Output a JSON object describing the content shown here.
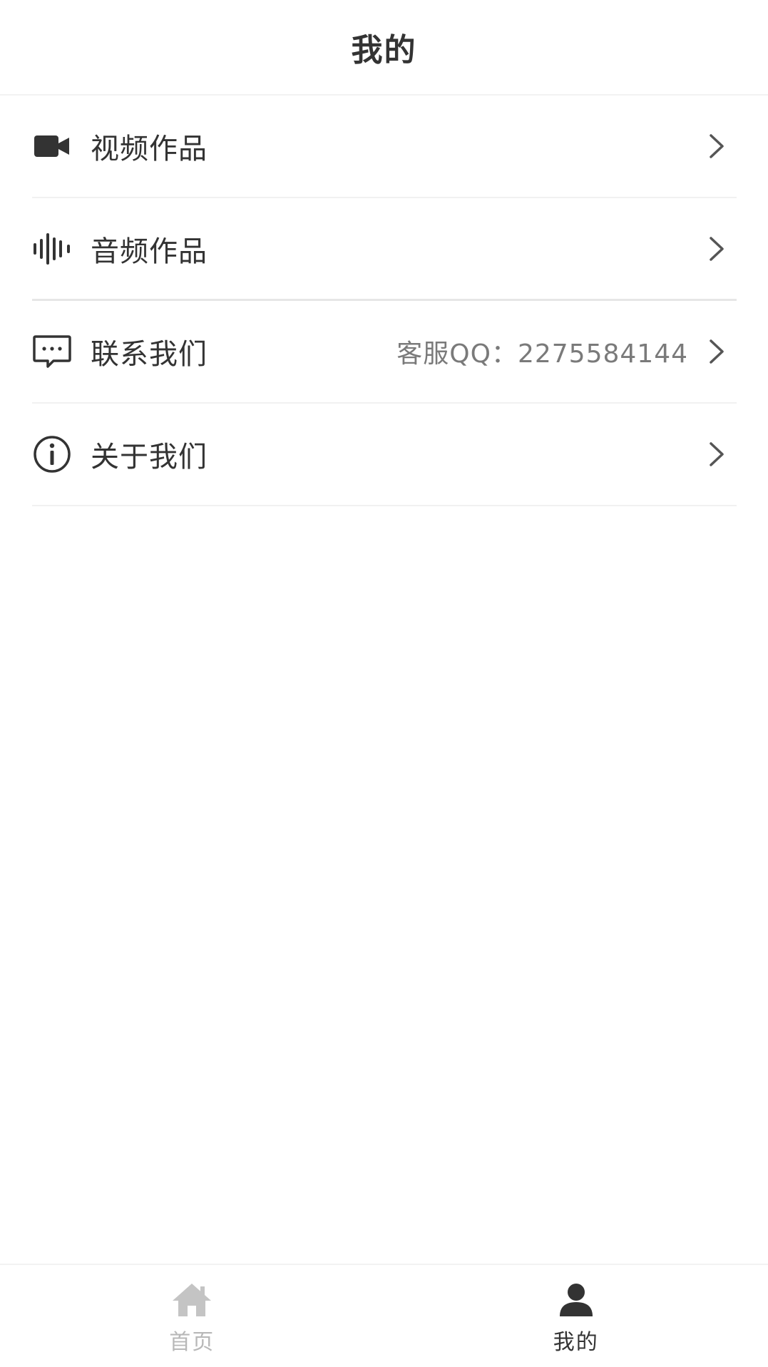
{
  "header": {
    "title": "我的"
  },
  "menu": {
    "items": [
      {
        "label": "视频作品",
        "icon": "video-camera-icon"
      },
      {
        "label": "音频作品",
        "icon": "audio-waveform-icon"
      },
      {
        "label": "联系我们",
        "icon": "message-icon",
        "extra": "客服QQ：2275584144"
      },
      {
        "label": "关于我们",
        "icon": "info-icon"
      }
    ]
  },
  "tabbar": {
    "tabs": [
      {
        "label": "首页",
        "icon": "home-icon",
        "active": false
      },
      {
        "label": "我的",
        "icon": "user-icon",
        "active": true
      }
    ]
  },
  "colors": {
    "text_primary": "#333333",
    "text_secondary": "#7a7a7a",
    "tab_inactive": "#b8b8b8",
    "divider": "#f1f1f1"
  }
}
